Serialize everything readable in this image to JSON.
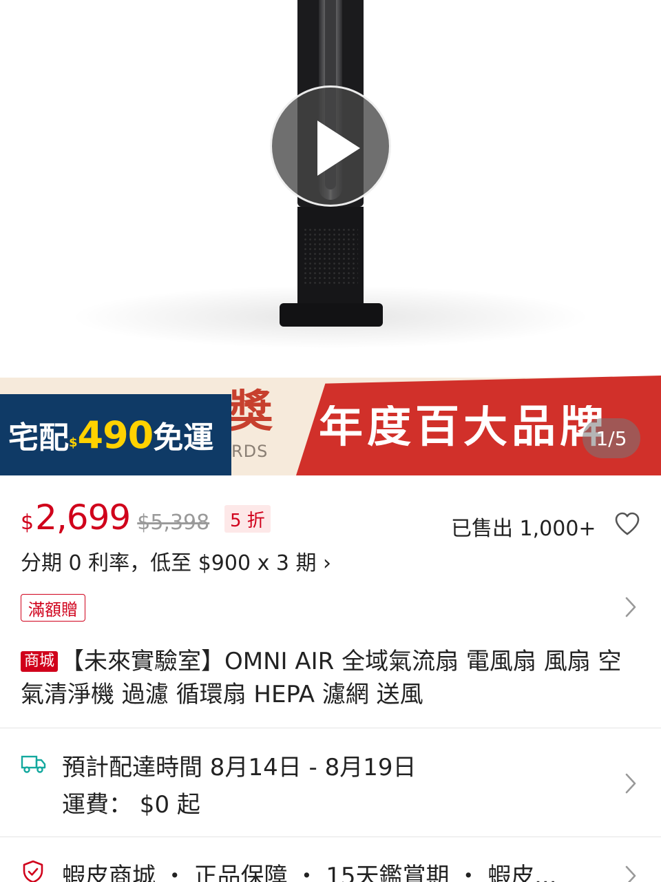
{
  "media": {
    "page_counter": "1/5",
    "play_icon": "play-icon"
  },
  "banner": {
    "award_char": "獎",
    "award_text": "RDS",
    "brand_title": "年度百大品牌",
    "shipping_prefix": "宅配",
    "shipping_currency": "$",
    "shipping_amount": "490",
    "shipping_suffix": "免運"
  },
  "price": {
    "currency": "$",
    "current": "2,699",
    "original": "$5,398",
    "discount": "5 折",
    "sold": "已售出 1,000+",
    "installment": "分期 0 利率，低至 $900 x 3 期 ›"
  },
  "promo": {
    "tag": "滿額贈"
  },
  "product": {
    "mall_badge": "商城",
    "title": "【未來實驗室】OMNI AIR 全域氣流扇 電風扇 風扇 空氣清淨機 過濾 循環扇 HEPA 濾網 送風"
  },
  "shipping": {
    "delivery_time": "預計配達時間 8月14日 - 8月19日",
    "fee": "運費： $0 起"
  },
  "guarantee": {
    "text": "蝦皮商城 ・ 正品保障 ・ 15天鑑賞期 ・ 蝦皮..."
  },
  "colors": {
    "price_red": "#d0011b",
    "banner_red": "#d1302a",
    "banner_navy": "#0f3a66",
    "highlight_yellow": "#ffd200"
  }
}
